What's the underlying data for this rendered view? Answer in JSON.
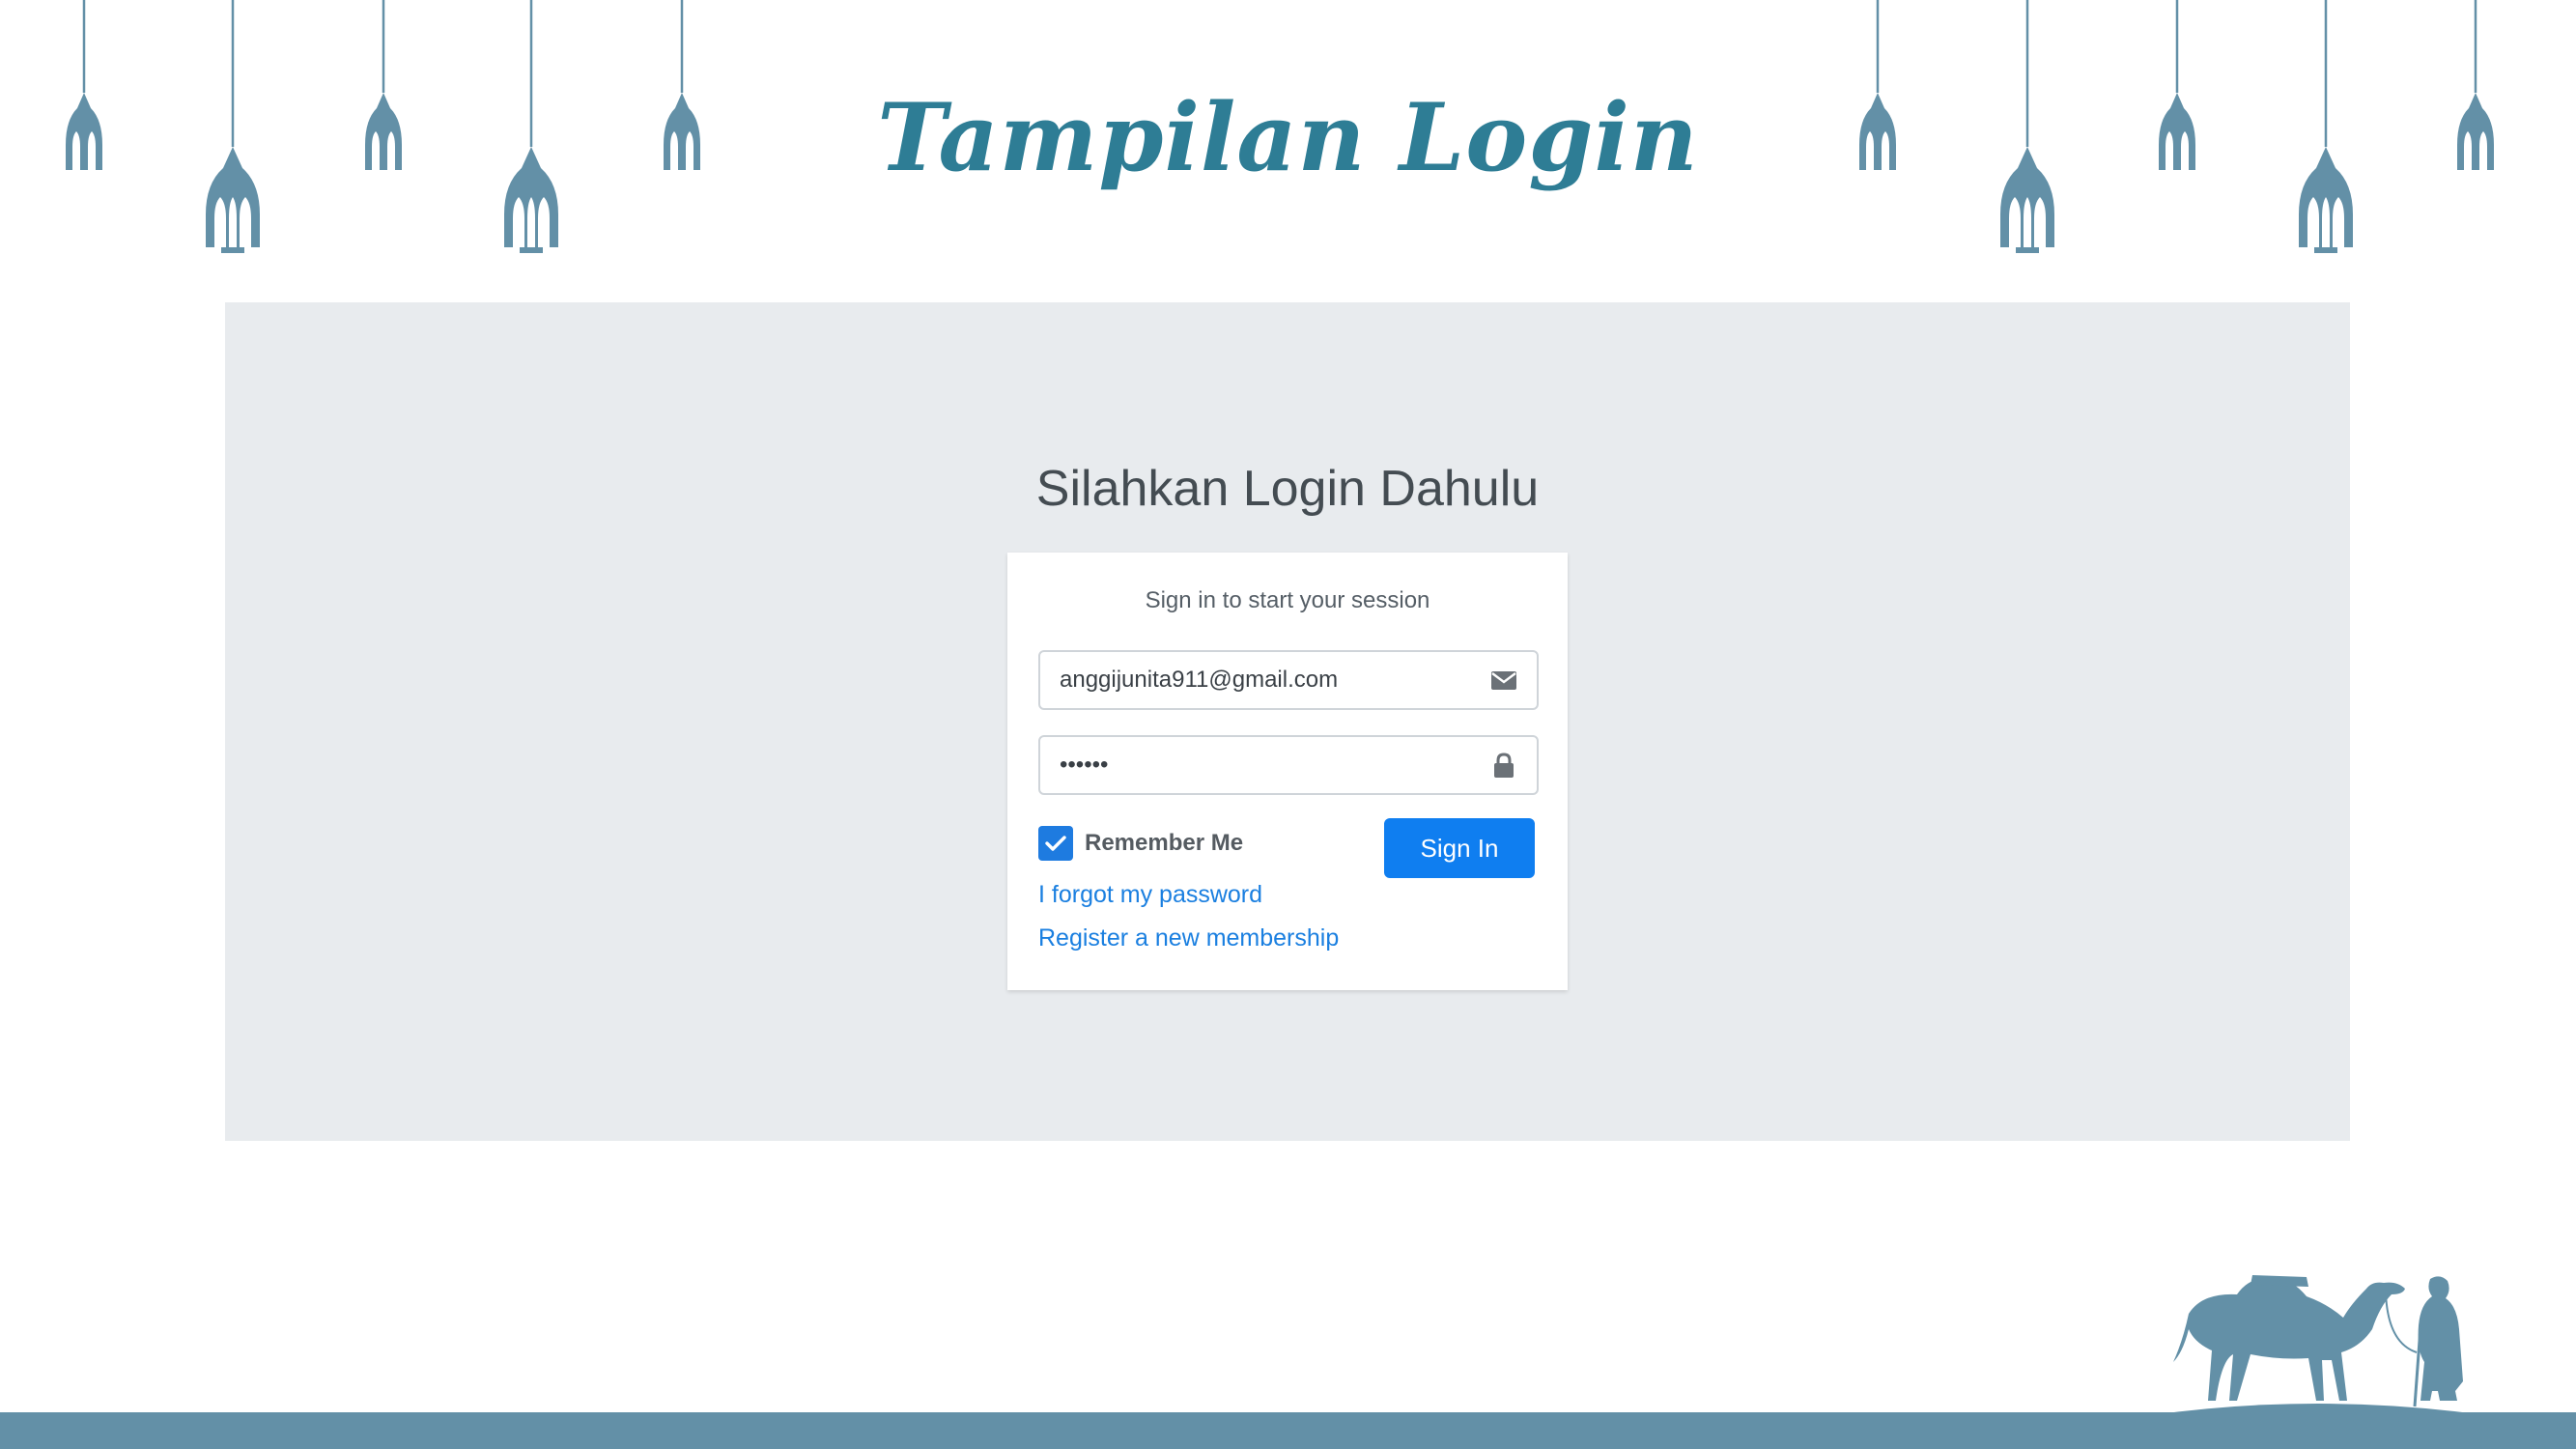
{
  "slide": {
    "title": "Tampilan Login"
  },
  "login_page": {
    "heading": "Silahkan Login Dahulu",
    "box_message": "Sign in to start your session",
    "email": {
      "value": "anggijunita911@gmail.com",
      "icon": "envelope-icon"
    },
    "password": {
      "value": "••••••",
      "icon": "lock-icon"
    },
    "remember_me": {
      "label": "Remember Me",
      "checked": true
    },
    "sign_in_label": "Sign In",
    "forgot_link": "I forgot my password",
    "register_link": "Register a new membership"
  },
  "colors": {
    "title": "#2e7d95",
    "lantern": "#6390a7",
    "panel_bg": "#e8ebee",
    "primary_button": "#0f7ef0",
    "link": "#1a7fe0",
    "bottom_bar": "#6390a7"
  }
}
